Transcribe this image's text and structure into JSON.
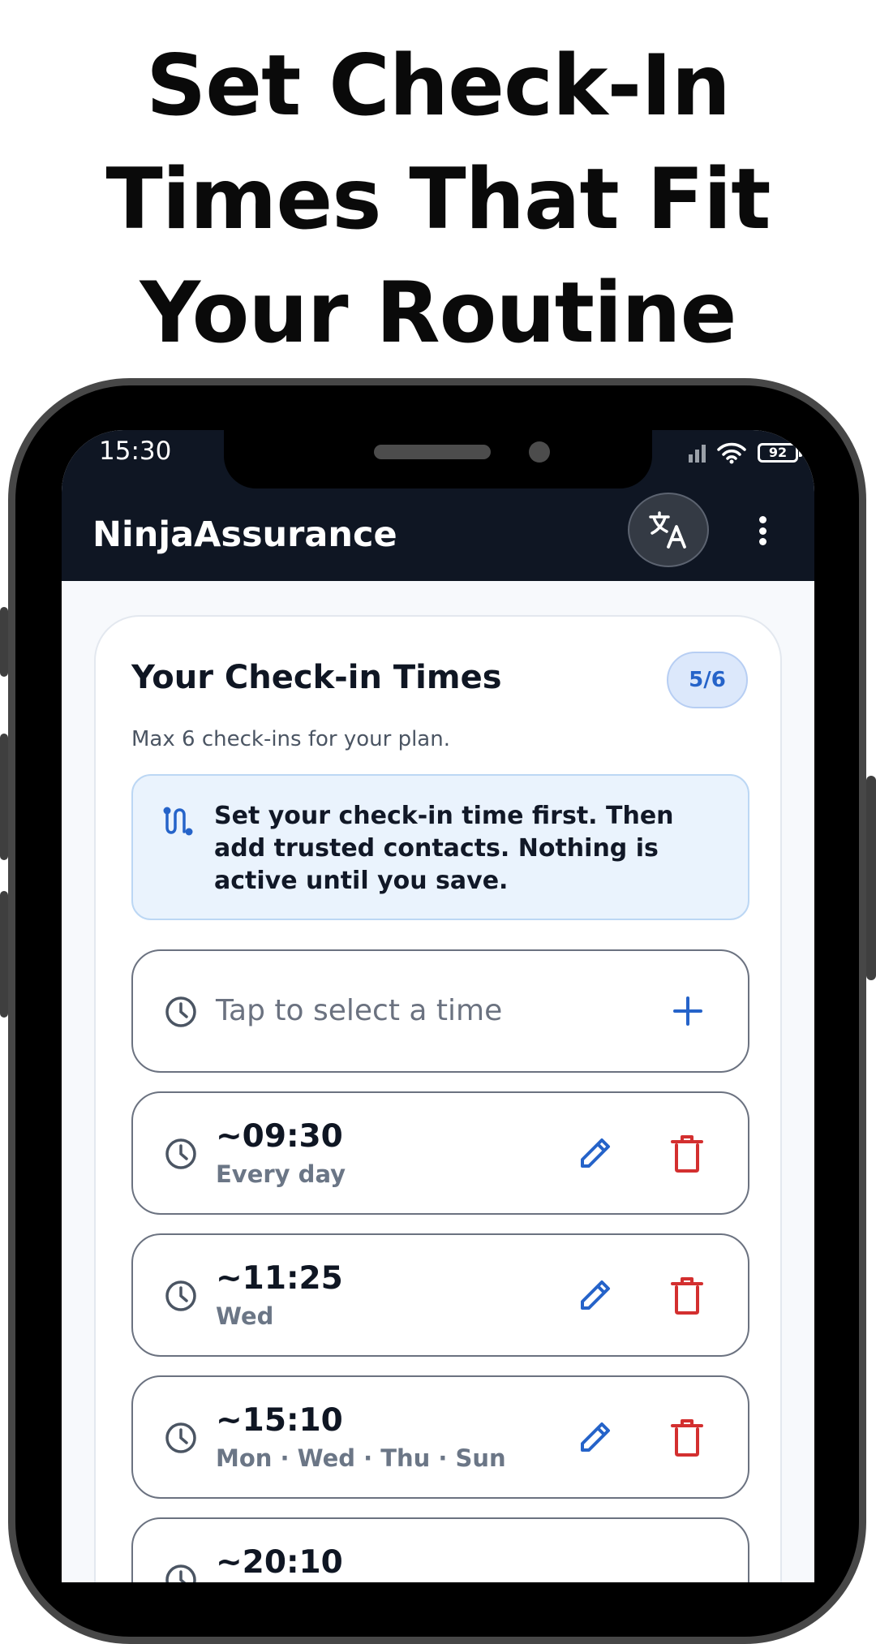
{
  "promo": {
    "line1": "Set Check-In",
    "line2": "Times That Fit",
    "line3": "Your Routine"
  },
  "status_bar": {
    "time": "15:30",
    "battery": "92"
  },
  "app_bar": {
    "title": "NinjaAssurance",
    "translate_icon": "translate-icon",
    "menu_icon": "more-vert-icon"
  },
  "card": {
    "title": "Your Check-in Times",
    "count_badge": "5/6",
    "subtitle": "Max 6 check-ins for your plan.",
    "info": "Set your check-in time first. Then add trusted contacts. Nothing is active until you save.",
    "add_placeholder": "Tap to select a time",
    "entries": [
      {
        "time": "~09:30",
        "days": "Every day"
      },
      {
        "time": "~11:25",
        "days": "Wed"
      },
      {
        "time": "~15:10",
        "days": "Mon · Wed · Thu · Sun"
      },
      {
        "time": "~20:10",
        "days": ""
      }
    ]
  },
  "colors": {
    "accent": "#2563c9",
    "danger": "#d32f2f",
    "appbar": "#0f1623"
  }
}
